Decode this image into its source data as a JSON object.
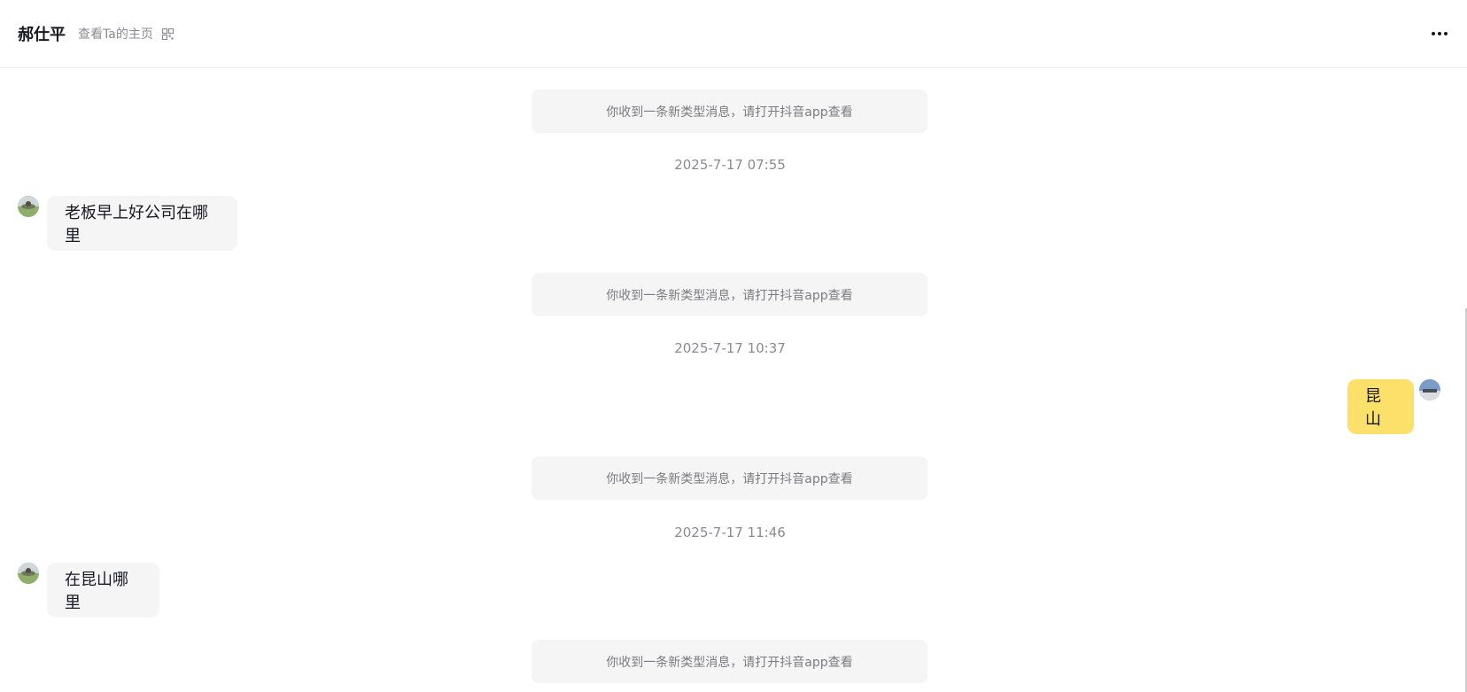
{
  "header": {
    "contact_name": "郝仕平",
    "profile_link": "查看Ta的主页",
    "qr_icon": "qr-code-icon",
    "more_icon": "more-horizontal-icon"
  },
  "messages": {
    "system_notice_1": "你收到一条新类型消息，请打开抖音app查看",
    "time_1": "2025-7-17 07:55",
    "incoming_1": "老板早上好公司在哪里",
    "system_notice_2": "你收到一条新类型消息，请打开抖音app查看",
    "time_2": "2025-7-17 10:37",
    "outgoing_1": "昆山",
    "system_notice_3": "你收到一条新类型消息，请打开抖音app查看",
    "time_3": "2025-7-17 11:46",
    "incoming_2": "在昆山哪里",
    "system_notice_4": "你收到一条新类型消息，请打开抖音app查看"
  },
  "colors": {
    "outgoing_bubble": "#fbe06a",
    "incoming_bubble": "#f5f5f5",
    "system_bubble": "#f5f5f5"
  }
}
